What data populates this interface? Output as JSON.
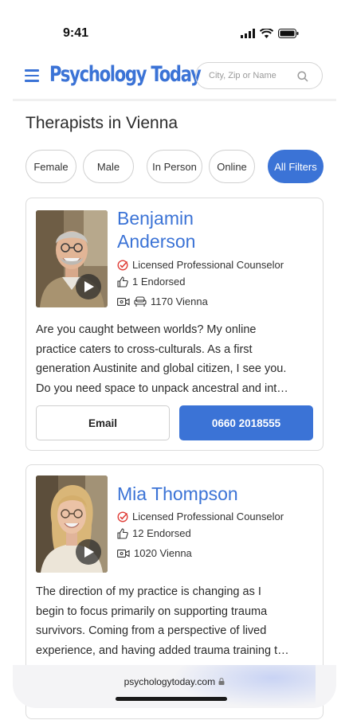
{
  "status": {
    "time": "9:41"
  },
  "header": {
    "logo": "Psychology Today",
    "search_placeholder": "City, Zip or Name"
  },
  "page_title": "Therapists in Vienna",
  "filters": [
    "Female",
    "Male",
    "In Person",
    "Online",
    "All Filters"
  ],
  "therapists": [
    {
      "name_line1": "Benjamin",
      "name_line2": "Anderson",
      "credential": "Licensed Professional Counselor",
      "endorsed": "1 Endorsed",
      "location": "1170 Vienna",
      "desc": [
        "Are you caught between worlds? My online",
        "practice caters to cross-culturals. As a first",
        "generation Austinite and global citizen, I see you.",
        "Do you need space to unpack ancestral and int…"
      ],
      "email_label": "Email",
      "phone_label": "0660 2018555"
    },
    {
      "name_line1": "Mia Thompson",
      "credential": "Licensed Professional Counselor",
      "endorsed": "12 Endorsed",
      "location": "1020 Vienna",
      "desc": [
        "The direction of my practice is changing as I",
        "begin to focus primarily on supporting trauma",
        "survivors. Coming from a perspective of lived",
        "experience, and having added trauma training t…"
      ]
    }
  ],
  "browser": {
    "url": "psychologytoday.com"
  },
  "colors": {
    "accent": "#3b73d6",
    "credential_check": "#e0403a"
  }
}
